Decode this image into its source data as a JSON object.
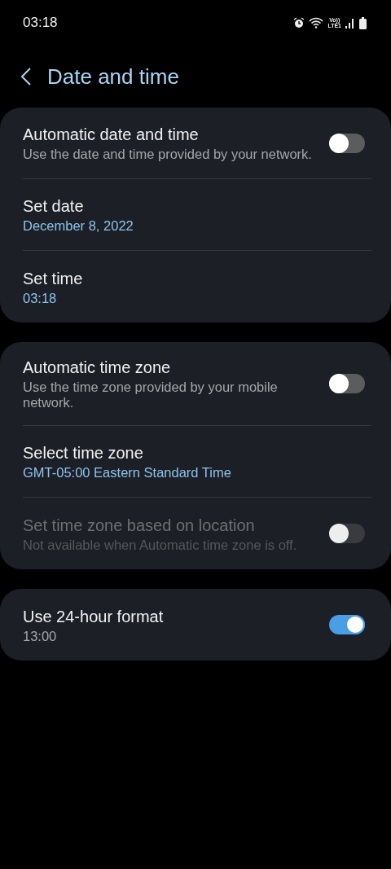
{
  "status_bar": {
    "time": "03:18",
    "volte": "Vo))",
    "network": "LTE1"
  },
  "header": {
    "title": "Date and time"
  },
  "groups": [
    {
      "items": [
        {
          "kind": "toggle",
          "title": "Automatic date and time",
          "subtitle": "Use the date and time provided by your network.",
          "on": false,
          "disabled": false
        },
        {
          "kind": "value",
          "title": "Set date",
          "subtitle": "December 8, 2022",
          "disabled": false
        },
        {
          "kind": "value",
          "title": "Set time",
          "subtitle": "03:18",
          "disabled": false
        }
      ]
    },
    {
      "items": [
        {
          "kind": "toggle",
          "title": "Automatic time zone",
          "subtitle": "Use the time zone provided by your mobile network.",
          "on": false,
          "disabled": false
        },
        {
          "kind": "value",
          "title": "Select time zone",
          "subtitle": "GMT-05:00 Eastern Standard Time",
          "disabled": false
        },
        {
          "kind": "toggle",
          "title": "Set time zone based on location",
          "subtitle": "Not available when Automatic time zone is off.",
          "on": false,
          "disabled": true
        }
      ]
    },
    {
      "items": [
        {
          "kind": "toggle",
          "title": "Use 24-hour format",
          "subtitle": "13:00",
          "on": true,
          "disabled": false
        }
      ]
    }
  ]
}
